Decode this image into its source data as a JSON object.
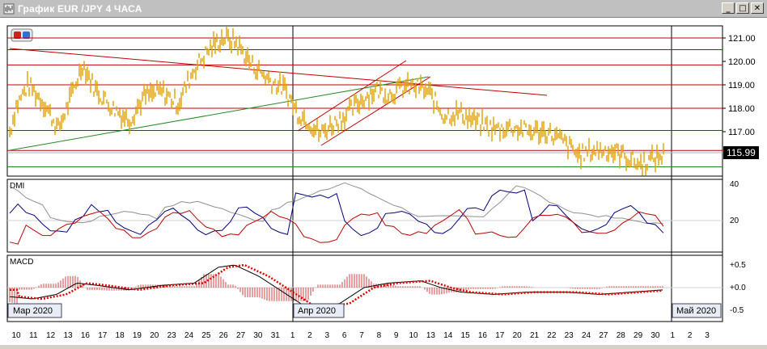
{
  "window": {
    "title": "График EUR /JPY  4 ЧАСА",
    "minimize_glyph": "_",
    "maximize_glyph": "□",
    "close_glyph": "✕"
  },
  "price_panel": {
    "axis_labels": [
      "121.00",
      "120.00",
      "119.00",
      "118.00",
      "117.00"
    ],
    "axis_values": [
      121.0,
      120.0,
      119.0,
      118.0,
      117.0
    ],
    "current_price": "115.99",
    "horizontal_levels": [
      121.0,
      120.5,
      119.85,
      119.0,
      118.0,
      117.05,
      116.2,
      115.5
    ]
  },
  "dmi_panel": {
    "label": "DMI",
    "axis_labels": [
      "40",
      "20"
    ]
  },
  "macd_panel": {
    "label": "MACD",
    "axis_labels": [
      "+0.5",
      "+0.0",
      "-0.5"
    ]
  },
  "month_labels": [
    "Мар 2020",
    "Апр 2020",
    "Май 2020"
  ],
  "date_axis": [
    "10",
    "11",
    "12",
    "13",
    "16",
    "17",
    "18",
    "19",
    "20",
    "23",
    "24",
    "25",
    "26",
    "27",
    "30",
    "31",
    "1",
    "2",
    "3",
    "6",
    "7",
    "8",
    "9",
    "10",
    "13",
    "14",
    "15",
    "16",
    "17",
    "20",
    "21",
    "22",
    "23",
    "24",
    "27",
    "28",
    "29",
    "30",
    "1",
    "2",
    "3"
  ],
  "colors": {
    "price": "#e0a000",
    "level": "#c00000",
    "trend_up": "#228b22",
    "dmi_plus": "#000080",
    "dmi_minus": "#c00000",
    "adx": "#909090",
    "macd_line": "#000000",
    "macd_signal": "#e00000"
  }
}
